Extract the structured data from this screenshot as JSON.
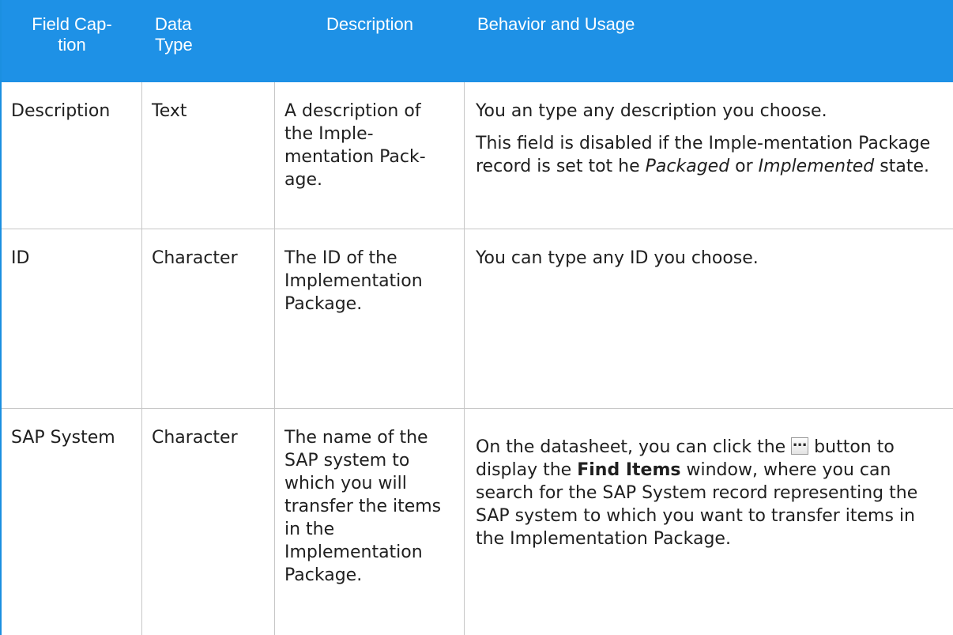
{
  "header": {
    "col1": "Field Cap-\ntion",
    "col2": "Data\nType",
    "col3": "Description",
    "col4": "Behavior and Usage"
  },
  "rows": [
    {
      "field": "Description",
      "type": "Text",
      "description": "A description of the Imple-mentation Pack-age.",
      "behavior_p1": "You an type any description you choose.",
      "behavior_p2_a": "This field is disabled if the Imple-mentation Package record is set tot he ",
      "behavior_p2_em1": "Packaged",
      "behavior_p2_b": " or ",
      "behavior_p2_em2": "Implemented",
      "behavior_p2_c": " state."
    },
    {
      "field": "ID",
      "type": "Character",
      "description": "The ID of the Implementation Package.",
      "behavior_p1": "You can type any ID you choose."
    },
    {
      "field": "SAP System",
      "type": "Character",
      "description": "The name of the SAP system to which you will transfer the items in the Implementation Package.",
      "behavior_a": "On the datasheet, you can click the ",
      "button_glyph": "…",
      "behavior_b": " button to display the ",
      "behavior_bold": "Find Items",
      "behavior_c": " window, where you can search for the SAP System record representing the SAP system to which you want to transfer items in the Implementation Package."
    }
  ]
}
